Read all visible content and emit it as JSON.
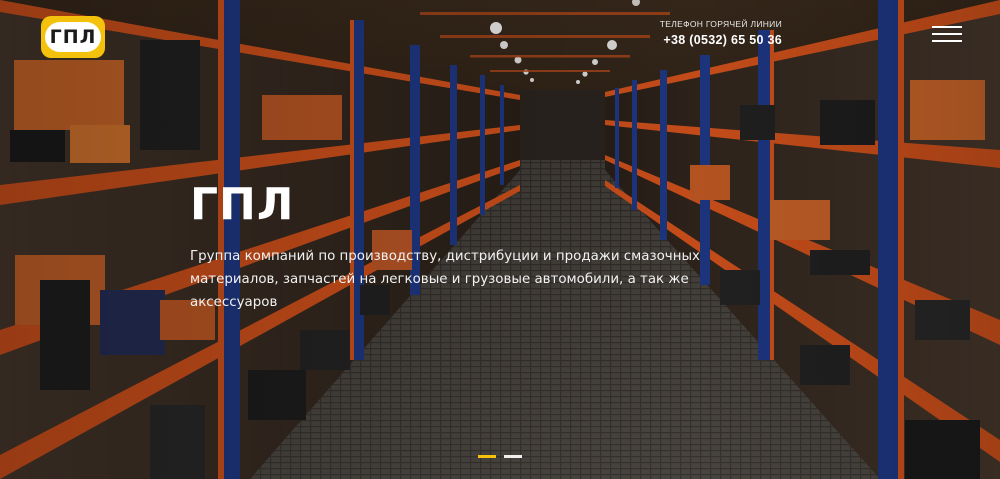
{
  "logo": {
    "text": "ГПЛ"
  },
  "hotline": {
    "label": "ТЕЛЕФОН ГОРЯЧЕЙ ЛИНИИ",
    "phone": "+38 (0532) 65 50 36"
  },
  "menu": {
    "icon": "hamburger-menu-icon"
  },
  "hero": {
    "title": "ГПЛ",
    "description": "Группа компаний по производству, дистрибуции и продажи смазочных материалов, запчастей на легковые и грузовые автомобили, а так же аксессуаров"
  },
  "slider": {
    "total": 2,
    "active": 1
  },
  "colors": {
    "brand_yellow": "#f4c20d",
    "rack_orange": "#d9541c",
    "rack_blue": "#1f3a8a"
  }
}
